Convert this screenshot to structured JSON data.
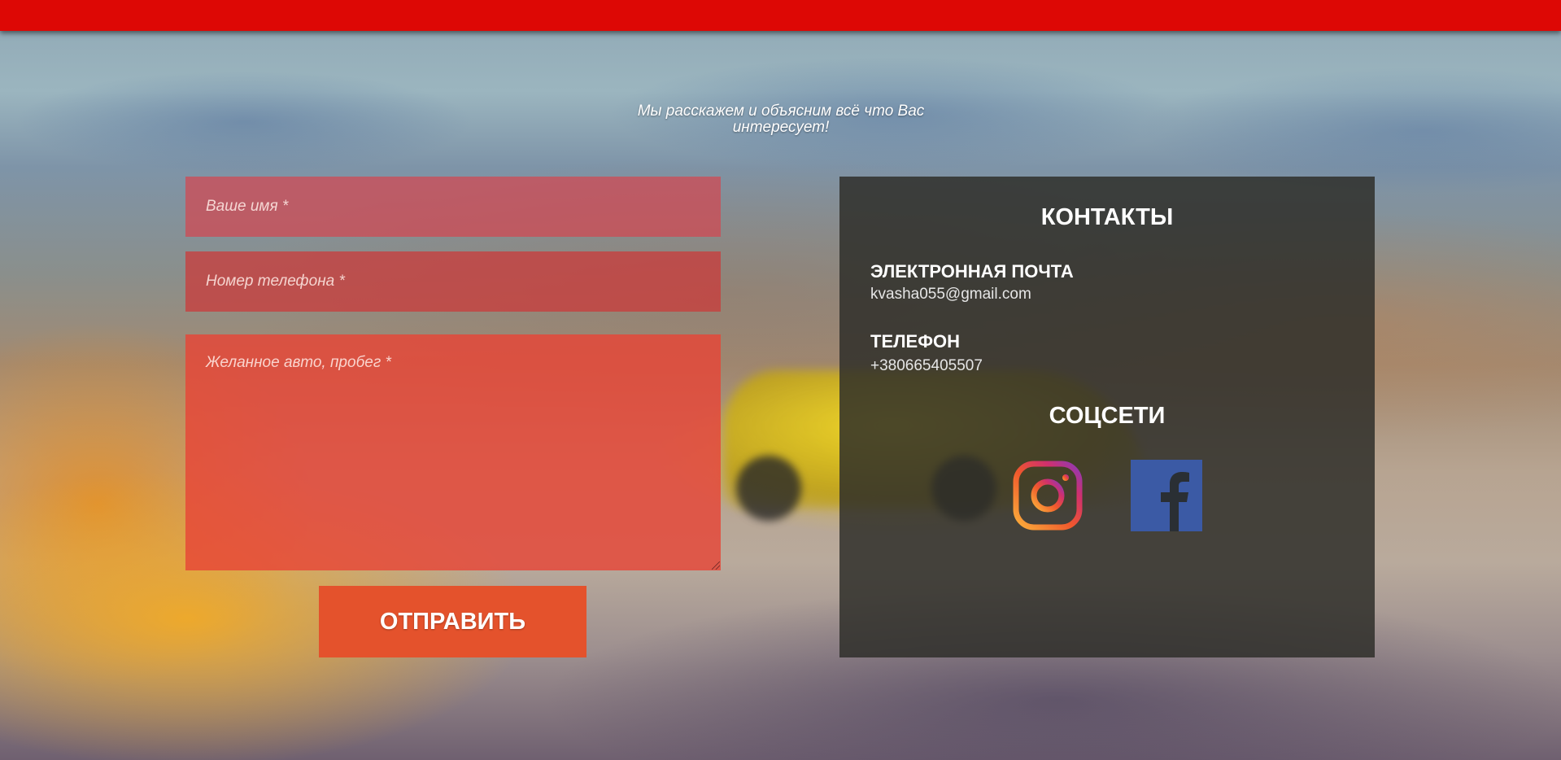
{
  "tagline": "Мы расскажем и объясним всё что Вас интересует!",
  "form": {
    "name_placeholder": "Ваше имя *",
    "phone_placeholder": "Номер телефона *",
    "car_placeholder": "Желанное авто, пробег *",
    "submit_label": "ОТПРАВИТЬ"
  },
  "contacts": {
    "title": "КОНТАКТЫ",
    "email_label": "ЭЛЕКТРОННАЯ ПОЧТА",
    "email_value": "kvasha055@gmail.com",
    "phone_label": "ТЕЛЕФОН",
    "phone_value": "+380665405507",
    "social_title": "СОЦСЕТИ",
    "social": [
      {
        "icon": "instagram-icon"
      },
      {
        "icon": "facebook-icon"
      }
    ]
  },
  "colors": {
    "topbar": "#dd0805",
    "button": "#e4522c",
    "facebook": "#3b5aa5"
  }
}
